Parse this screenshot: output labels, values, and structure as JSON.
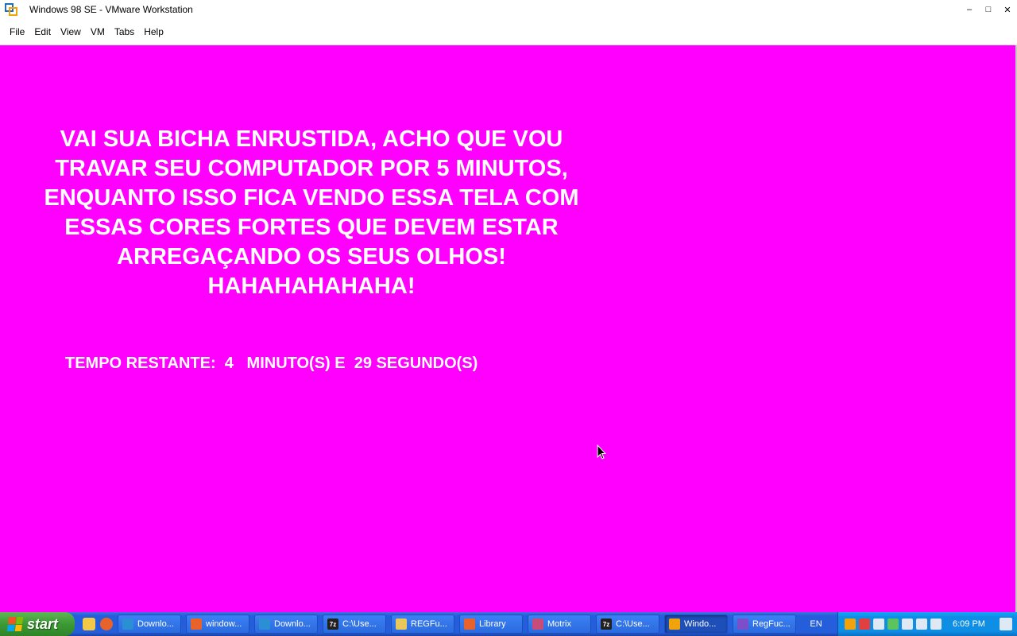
{
  "window": {
    "title": "Windows 98 SE - VMware Workstation",
    "minimize": "–",
    "maximize": "□",
    "close": "✕"
  },
  "menu": [
    "File",
    "Edit",
    "View",
    "VM",
    "Tabs",
    "Help"
  ],
  "guest": {
    "background_color": "#ff00ff",
    "message_lines": [
      "VAI SUA BICHA ENRUSTIDA, ACHO QUE VOU",
      "TRAVAR SEU COMPUTADOR POR 5 MINUTOS,",
      "ENQUANTO ISSO FICA VENDO ESSA TELA COM",
      "ESSAS CORES FORTES QUE DEVEM ESTAR",
      "ARREGAÇANDO OS SEUS OLHOS!",
      "HAHAHAHAHAHA!"
    ],
    "timer_text": "TEMPO RESTANTE:  4   MINUTO(S) E  29 SEGUNDO(S)"
  },
  "taskbar": {
    "start_label": "start",
    "tasks": [
      {
        "label": "Downlo...",
        "icon": "download-icon",
        "color": "#2b8fd6"
      },
      {
        "label": "window...",
        "icon": "firefox-icon",
        "color": "#e8632b"
      },
      {
        "label": "Downlo...",
        "icon": "download-icon",
        "color": "#2b8fd6"
      },
      {
        "label": "C:\\Use...",
        "icon": "7zip-icon",
        "color": "#222222",
        "glyph": "7z"
      },
      {
        "label": "REGFu...",
        "icon": "folder-icon",
        "color": "#e8c85a"
      },
      {
        "label": "Library",
        "icon": "firefox-icon",
        "color": "#e8632b"
      },
      {
        "label": "Motrix",
        "icon": "motrix-icon",
        "color": "#c64d7b"
      },
      {
        "label": "C:\\Use...",
        "icon": "7zip-icon",
        "color": "#222222",
        "glyph": "7z"
      },
      {
        "label": "Windo...",
        "icon": "vmware-icon",
        "color": "#f0a30a",
        "active": true
      },
      {
        "label": "RegFuc...",
        "icon": "visual-studio-icon",
        "color": "#7b4fc9"
      }
    ],
    "language": "EN",
    "clock": "6:09 PM"
  }
}
